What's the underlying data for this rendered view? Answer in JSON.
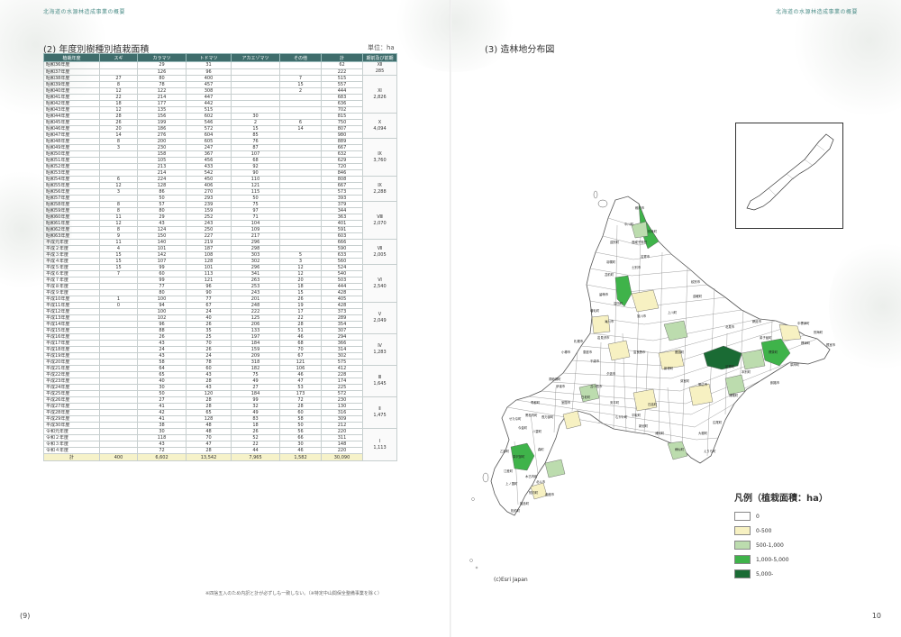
{
  "header": {
    "left_running_head": "北海道の水源林造成事業の概要",
    "right_running_head": "北海道の水源林造成事業の概要",
    "left_page_number": "(9)",
    "right_page_number": "10"
  },
  "table_section": {
    "title": "(2) 年度別樹種別植栽面積",
    "unit": "単位：ha",
    "columns": [
      "植栽年度",
      "スギ",
      "カラマツ",
      "トドマツ",
      "アカエゾマツ",
      "その他",
      "計",
      "期前及び前期"
    ],
    "rows": [
      [
        "昭和36年度",
        "",
        "29",
        "31",
        "",
        "",
        "62",
        ""
      ],
      [
        "昭和37年度",
        "",
        "126",
        "96",
        "",
        "",
        "222",
        ""
      ],
      [
        "昭和38年度",
        "27",
        "80",
        "400",
        "",
        "7",
        "515",
        ""
      ],
      [
        "昭和39年度",
        "8",
        "78",
        "457",
        "",
        "15",
        "557",
        ""
      ],
      [
        "昭和40年度",
        "12",
        "122",
        "308",
        "",
        "2",
        "444",
        ""
      ],
      [
        "昭和41年度",
        "22",
        "214",
        "447",
        "",
        "",
        "683",
        ""
      ],
      [
        "昭和42年度",
        "18",
        "177",
        "442",
        "",
        "",
        "636",
        ""
      ],
      [
        "昭和43年度",
        "12",
        "135",
        "515",
        "",
        "",
        "702",
        ""
      ],
      [
        "昭和44年度",
        "28",
        "156",
        "602",
        "30",
        "",
        "815",
        ""
      ],
      [
        "昭和45年度",
        "26",
        "199",
        "546",
        "2",
        "6",
        "750",
        ""
      ],
      [
        "昭和46年度",
        "20",
        "186",
        "572",
        "15",
        "14",
        "807",
        ""
      ],
      [
        "昭和47年度",
        "14",
        "276",
        "604",
        "85",
        "",
        "980",
        ""
      ],
      [
        "昭和48年度",
        "8",
        "200",
        "605",
        "76",
        "",
        "889",
        ""
      ],
      [
        "昭和49年度",
        "3",
        "230",
        "247",
        "87",
        "",
        "667",
        ""
      ],
      [
        "昭和50年度",
        "",
        "158",
        "367",
        "107",
        "",
        "632",
        ""
      ],
      [
        "昭和51年度",
        "",
        "105",
        "456",
        "68",
        "",
        "629",
        ""
      ],
      [
        "昭和52年度",
        "",
        "213",
        "433",
        "92",
        "",
        "720",
        ""
      ],
      [
        "昭和53年度",
        "",
        "214",
        "542",
        "90",
        "",
        "846",
        ""
      ],
      [
        "昭和54年度",
        "6",
        "224",
        "450",
        "110",
        "",
        "808",
        ""
      ],
      [
        "昭和55年度",
        "12",
        "128",
        "406",
        "121",
        "",
        "667",
        ""
      ],
      [
        "昭和56年度",
        "3",
        "86",
        "270",
        "115",
        "",
        "573",
        ""
      ],
      [
        "昭和57年度",
        "",
        "50",
        "293",
        "50",
        "",
        "393",
        ""
      ],
      [
        "昭和58年度",
        "8",
        "57",
        "239",
        "75",
        "",
        "379",
        ""
      ],
      [
        "昭和59年度",
        "8",
        "80",
        "159",
        "97",
        "",
        "344",
        ""
      ],
      [
        "昭和60年度",
        "11",
        "29",
        "252",
        "71",
        "",
        "363",
        ""
      ],
      [
        "昭和61年度",
        "12",
        "43",
        "243",
        "104",
        "",
        "401",
        ""
      ],
      [
        "昭和62年度",
        "8",
        "124",
        "250",
        "109",
        "",
        "591",
        ""
      ],
      [
        "昭和63年度",
        "9",
        "150",
        "227",
        "217",
        "",
        "603",
        ""
      ],
      [
        "平成元年度",
        "11",
        "140",
        "219",
        "296",
        "",
        "666",
        ""
      ],
      [
        "平成２年度",
        "4",
        "101",
        "187",
        "298",
        "",
        "590",
        ""
      ],
      [
        "平成３年度",
        "15",
        "142",
        "108",
        "303",
        "5",
        "633",
        ""
      ],
      [
        "平成４年度",
        "15",
        "107",
        "128",
        "302",
        "3",
        "560",
        ""
      ],
      [
        "平成５年度",
        "15",
        "99",
        "101",
        "296",
        "12",
        "524",
        ""
      ],
      [
        "平成６年度",
        "7",
        "60",
        "113",
        "341",
        "12",
        "540",
        ""
      ],
      [
        "平成７年度",
        "",
        "99",
        "121",
        "263",
        "20",
        "503",
        ""
      ],
      [
        "平成８年度",
        "",
        "77",
        "96",
        "253",
        "18",
        "444",
        ""
      ],
      [
        "平成９年度",
        "",
        "80",
        "90",
        "243",
        "15",
        "428",
        ""
      ],
      [
        "平成10年度",
        "1",
        "100",
        "77",
        "201",
        "26",
        "405",
        ""
      ],
      [
        "平成11年度",
        "0",
        "94",
        "67",
        "248",
        "19",
        "428",
        ""
      ],
      [
        "平成12年度",
        "",
        "100",
        "24",
        "222",
        "17",
        "373",
        ""
      ],
      [
        "平成13年度",
        "",
        "102",
        "40",
        "125",
        "22",
        "289",
        ""
      ],
      [
        "平成14年度",
        "",
        "96",
        "26",
        "206",
        "28",
        "354",
        ""
      ],
      [
        "平成15年度",
        "",
        "88",
        "35",
        "133",
        "51",
        "307",
        ""
      ],
      [
        "平成16年度",
        "",
        "26",
        "25",
        "197",
        "46",
        "294",
        ""
      ],
      [
        "平成17年度",
        "",
        "43",
        "70",
        "184",
        "68",
        "366",
        ""
      ],
      [
        "平成18年度",
        "",
        "24",
        "26",
        "159",
        "70",
        "314",
        ""
      ],
      [
        "平成19年度",
        "",
        "43",
        "24",
        "209",
        "67",
        "302",
        ""
      ],
      [
        "平成20年度",
        "",
        "58",
        "78",
        "318",
        "121",
        "575",
        ""
      ],
      [
        "平成21年度",
        "",
        "64",
        "60",
        "182",
        "106",
        "412",
        ""
      ],
      [
        "平成22年度",
        "",
        "65",
        "43",
        "75",
        "46",
        "228",
        ""
      ],
      [
        "平成23年度",
        "",
        "40",
        "28",
        "49",
        "47",
        "174",
        ""
      ],
      [
        "平成24年度",
        "",
        "30",
        "43",
        "27",
        "53",
        "225",
        ""
      ],
      [
        "平成25年度",
        "",
        "50",
        "120",
        "184",
        "173",
        "572",
        ""
      ],
      [
        "平成26年度",
        "",
        "27",
        "28",
        "99",
        "72",
        "230",
        ""
      ],
      [
        "平成27年度",
        "",
        "41",
        "28",
        "32",
        "28",
        "130",
        ""
      ],
      [
        "平成28年度",
        "",
        "42",
        "65",
        "49",
        "60",
        "316",
        ""
      ],
      [
        "平成29年度",
        "",
        "41",
        "128",
        "83",
        "58",
        "309",
        ""
      ],
      [
        "平成30年度",
        "",
        "38",
        "48",
        "18",
        "50",
        "212",
        ""
      ],
      [
        "令和元年度",
        "",
        "30",
        "48",
        "26",
        "56",
        "220",
        ""
      ],
      [
        "令和２年度",
        "",
        "118",
        "70",
        "52",
        "66",
        "311",
        ""
      ],
      [
        "令和３年度",
        "",
        "43",
        "47",
        "22",
        "30",
        "148",
        ""
      ],
      [
        "令和４年度",
        "",
        "72",
        "28",
        "44",
        "46",
        "220",
        ""
      ]
    ],
    "period_groups": [
      {
        "label": "Ⅻ",
        "total": "285",
        "span": 2
      },
      {
        "label": "Ⅺ",
        "total": "2,826",
        "span": 6
      },
      {
        "label": "Ⅹ",
        "total": "4,094",
        "span": 4
      },
      {
        "label": "Ⅸ",
        "total": "3,760",
        "span": 6
      },
      {
        "label": "Ⅸ",
        "total": "2,288",
        "span": 4
      },
      {
        "label": "Ⅷ",
        "total": "2,070",
        "span": 6
      },
      {
        "label": "Ⅶ",
        "total": "2,005",
        "span": 4
      },
      {
        "label": "Ⅵ",
        "total": "2,540",
        "span": 6
      },
      {
        "label": "Ⅴ",
        "total": "2,049",
        "span": 5
      },
      {
        "label": "Ⅳ",
        "total": "1,283",
        "span": 5
      },
      {
        "label": "Ⅲ",
        "total": "1,645",
        "span": 5
      },
      {
        "label": "Ⅱ",
        "total": "1,475",
        "span": 5
      },
      {
        "label": "Ⅰ",
        "total": "1,113",
        "span": 5
      }
    ],
    "total_row": [
      "計",
      "400",
      "6,602",
      "13,542",
      "7,965",
      "1,582",
      "30,090",
      ""
    ],
    "footnote": "※四捨五入のため内訳と計が必ずしも一致しない。（※特定中山間保全整備事業を除く）"
  },
  "map_section": {
    "title": "(3) 造林地分布図",
    "credit": "(c)Esri Japan",
    "legend_title": "凡例（植栽面積：ha）",
    "legend": [
      {
        "label": "0",
        "color": "#ffffff"
      },
      {
        "label": "0-500",
        "color": "#f7f1c2"
      },
      {
        "label": "500-1,000",
        "color": "#bcdcae"
      },
      {
        "label": "1,000-5,000",
        "color": "#3fb34a"
      },
      {
        "label": "5,000-",
        "color": "#1a6b34"
      }
    ],
    "labels": [
      "稚内市",
      "中川町",
      "枝幸町",
      "遠別町",
      "音威子府村",
      "名寄市",
      "羽幌町",
      "苫前町",
      "士別市",
      "留萌市",
      "旭川市",
      "滝川市",
      "富良野市",
      "上川町",
      "遠軽町",
      "北見市",
      "網走市",
      "紋別市",
      "足寄町",
      "標津町",
      "釧路市",
      "厚岸町",
      "帯広市",
      "芽室町",
      "新得町",
      "日高町",
      "平取町",
      "浦河町",
      "様似町",
      "えりも町",
      "千歳市",
      "恵庭市",
      "札幌市",
      "小樽市",
      "岩見沢市",
      "夕張市",
      "苫小牧市",
      "白老町",
      "室蘭市",
      "伊達市",
      "洞爺湖町",
      "寿都町",
      "黒松内町",
      "今金町",
      "せたな町",
      "八雲町",
      "森町",
      "北斗市",
      "函館市",
      "江差町",
      "上ノ国町",
      "松前町",
      "福島町",
      "知内町",
      "木古内町",
      "厚沢部町",
      "長万部町",
      "乙部町",
      "鹿追町",
      "本別町",
      "中標津町",
      "別海町",
      "根室市",
      "弟子屈町",
      "標茶町",
      "浦幌町",
      "広尾町",
      "大樹町",
      "むかわ町",
      "安平町",
      "新冠町",
      "沼田町",
      "増毛町"
    ]
  }
}
